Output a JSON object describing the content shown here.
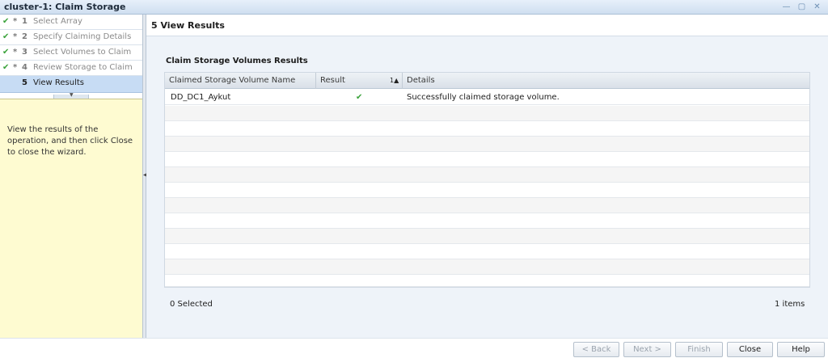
{
  "window": {
    "title": "cluster-1: Claim Storage"
  },
  "steps": [
    {
      "check": "✔",
      "star": "*",
      "num": "1",
      "label": "Select Array"
    },
    {
      "check": "✔",
      "star": "*",
      "num": "2",
      "label": "Specify Claiming Details"
    },
    {
      "check": "✔",
      "star": "*",
      "num": "3",
      "label": "Select Volumes to Claim"
    },
    {
      "check": "✔",
      "star": "*",
      "num": "4",
      "label": "Review Storage to Claim"
    },
    {
      "check": "",
      "star": "",
      "num": "5",
      "label": "View Results"
    }
  ],
  "help": {
    "text": "View the results of the operation, and then click Close to close the wizard."
  },
  "main": {
    "header": "5  View Results",
    "section_title": "Claim Storage Volumes Results",
    "table": {
      "columns": [
        "Claimed Storage Volume Name",
        "Result",
        "Details"
      ],
      "sort_indicator": "1▲",
      "rows": [
        {
          "name": "DD_DC1_Aykut",
          "result": "✔",
          "details": "Successfully claimed storage volume."
        }
      ]
    },
    "selected_count": "0 Selected",
    "items_count": "1 items"
  },
  "buttons": {
    "back": "< Back",
    "next": "Next >",
    "finish": "Finish",
    "close": "Close",
    "help": "Help"
  },
  "colors": {
    "accent": "#c7dcf4",
    "help_bg": "#fefbd1",
    "check_green": "#3aa23a"
  }
}
